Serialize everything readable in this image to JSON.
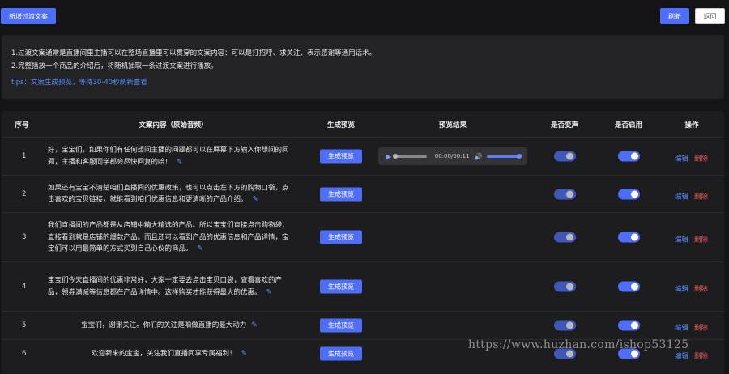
{
  "toolbar": {
    "add_label": "新增过渡文案",
    "refresh_label": "刷新",
    "back_label": "返回"
  },
  "notice": {
    "line1": "1.过渡文案通常是直播间里主播可以在整场直播里可以贯穿的文案内容：可以是打招呼、求关注、表示感谢等通用话术。",
    "line2": "2.完整播放一个商品的介绍后，将随机抽取一条过渡文案进行播放。",
    "tips": "tips：文案生成预览，等待30-40秒刷新查看"
  },
  "table": {
    "headers": {
      "index": "序号",
      "content": "文案内容（原始音频）",
      "gen": "生成预览",
      "result": "预览结果",
      "voice": "是否变声",
      "enabled": "是否启用",
      "ops": "操作"
    },
    "gen_label": "生成预览",
    "edit_label": "编辑",
    "delete_label": "删除",
    "audio_time": "00:00/00:11",
    "rows": [
      {
        "index": "1",
        "content": "好，宝宝们，如果你们有任何想问主播的问题都可以在屏幕下方输入你想问的问题，主播和客服同学都会尽快回复的哈！",
        "voice": "off",
        "enabled": "on",
        "has_audio": true
      },
      {
        "index": "2",
        "content": "如果还有宝宝不清楚咱们直播间的优惠政策，也可以点击左下方的购物口袋，点击喜欢的宝贝链接，就能看到咱们优惠信息和更清晰的产品介绍。",
        "voice": "off",
        "enabled": "on"
      },
      {
        "index": "3",
        "content": "我们直播间的产品都是从店铺中精大精选的产品。所以宝宝们直接点击购物袋，直接看到就是店铺的爆款产品。而且还可以看到产品的优惠信息和产品详情，宝宝们可以用最简单的方式买到自己心仪的商品。",
        "voice": "off",
        "enabled": "on"
      },
      {
        "index": "4",
        "content": "宝宝们今天直播间的优惠非常好，大家一定要去点击宝贝口袋，查看喜欢的产品，领券满减等信息都在产品详情中。这样购买才能获得最大的优惠。",
        "voice": "off",
        "enabled": "on"
      },
      {
        "index": "5",
        "content": "宝宝们，谢谢关注。你们的关注是咱做直播的最大动力",
        "voice": "off",
        "enabled": "on"
      },
      {
        "index": "6",
        "content": "欢迎新来的宝宝，关注我们直播间享专属福利！",
        "voice": "off",
        "enabled": "on"
      }
    ]
  },
  "watermark": "https://www.huzhan.com/ishop53125",
  "colors": {
    "background": "#141416",
    "panel": "#232326",
    "table": "#1d1d20",
    "primary": "#4f6ef7",
    "link": "#5b8cff",
    "danger": "#f05a5a"
  }
}
